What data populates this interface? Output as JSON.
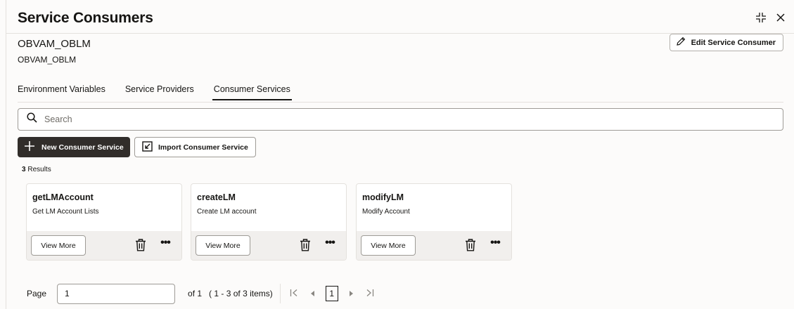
{
  "header": {
    "title": "Service Consumers"
  },
  "consumer": {
    "name": "OBVAM_OBLM",
    "description": "OBVAM_OBLM",
    "edit_label": "Edit Service Consumer"
  },
  "tabs": [
    {
      "label": "Environment Variables",
      "active": false
    },
    {
      "label": "Service Providers",
      "active": false
    },
    {
      "label": "Consumer Services",
      "active": true
    }
  ],
  "search": {
    "placeholder": "Search",
    "value": ""
  },
  "actions": {
    "new_label": "New Consumer Service",
    "import_label": "Import Consumer Service"
  },
  "results": {
    "count": "3",
    "label": "Results"
  },
  "cards": [
    {
      "title": "getLMAccount",
      "description": "Get LM Account Lists",
      "view_label": "View More"
    },
    {
      "title": "createLM",
      "description": "Create LM account",
      "view_label": "View More"
    },
    {
      "title": "modifyLM",
      "description": "Modify Account",
      "view_label": "View More"
    }
  ],
  "pagination": {
    "page_label": "Page",
    "page_value": "1",
    "of_label": "of 1",
    "range_label": "( 1 - 3 of 3 items)",
    "current_page": "1"
  },
  "icons": {
    "collapse": "collapse-icon",
    "close": "close-icon",
    "edit": "pencil-icon",
    "search": "search-icon",
    "add": "plus-icon",
    "import": "import-icon",
    "delete": "trash-icon",
    "more": "more-icon",
    "first": "first-page-icon",
    "prev": "previous-page-icon",
    "next": "next-page-icon",
    "last": "last-page-icon"
  }
}
